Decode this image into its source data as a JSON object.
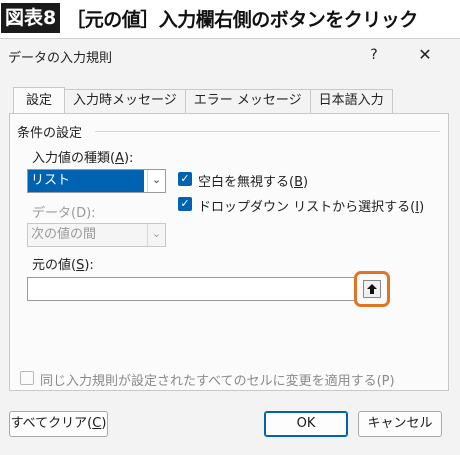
{
  "figure": {
    "label": "図表8",
    "caption": "［元の値］入力欄右側のボタンをクリック"
  },
  "dialog": {
    "title": "データの入力規則",
    "help_icon": "?",
    "close_icon": "✕"
  },
  "tabs": [
    {
      "label": "設定",
      "active": true
    },
    {
      "label": "入力時メッセージ",
      "active": false
    },
    {
      "label": "エラー メッセージ",
      "active": false
    },
    {
      "label": "日本語入力",
      "active": false
    }
  ],
  "settings": {
    "section_title": "条件の設定",
    "allow": {
      "label_pre": "入力値の種類(",
      "label_key": "A",
      "label_post": "):",
      "value": "リスト"
    },
    "data": {
      "label": "データ(D):",
      "value": "次の値の間"
    },
    "ignore_blank": {
      "label_pre": "空白を無視する(",
      "label_key": "B",
      "label_post": ")",
      "checked": true
    },
    "in_cell_dropdown": {
      "label_pre": "ドロップダウン リストから選択する(",
      "label_key": "I",
      "label_post": ")",
      "checked": true
    },
    "source": {
      "label_pre": "元の値(",
      "label_key": "S",
      "label_post": "):",
      "value": ""
    },
    "apply_all": {
      "label": "同じ入力規則が設定されたすべてのセルに変更を適用する(P)",
      "checked": false
    }
  },
  "buttons": {
    "clear_all_pre": "すべてクリア(",
    "clear_all_key": "C",
    "clear_all_post": ")",
    "ok": "OK",
    "cancel": "キャンセル"
  },
  "colors": {
    "accent": "#0063b1",
    "highlight_ring": "#e07424"
  }
}
